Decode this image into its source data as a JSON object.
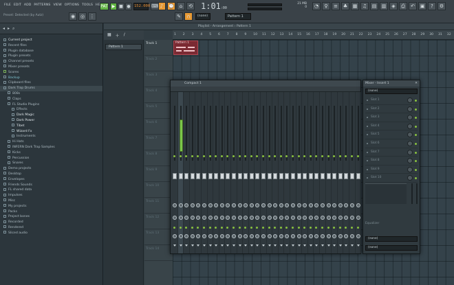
{
  "toolbar": {
    "menu": [
      "FILE",
      "EDIT",
      "ADD",
      "PATTERNS",
      "VIEW",
      "OPTIONS",
      "TOOLS",
      "HELP"
    ],
    "hint": "Preset: Detected (by Autz)",
    "pat_label": "PAT",
    "tempo": "152.000",
    "clock": "1:01",
    "clock_sub": ":00",
    "cpu_label": "21 MB",
    "cpu_value": "0",
    "line_mode": "(none)",
    "pattern": "Pattern 1"
  },
  "browser": {
    "items": [
      {
        "label": "Current project",
        "indent": 0,
        "style": "white"
      },
      {
        "label": "Recent files",
        "indent": 0,
        "style": ""
      },
      {
        "label": "Plugin database",
        "indent": 0,
        "style": ""
      },
      {
        "label": "Plugin presets",
        "indent": 0,
        "style": ""
      },
      {
        "label": "Channel presets",
        "indent": 0,
        "style": ""
      },
      {
        "label": "Mixer presets",
        "indent": 0,
        "style": ""
      },
      {
        "label": "Scores",
        "indent": 0,
        "style": "green"
      },
      {
        "label": "Backup",
        "indent": 0,
        "style": "cyan"
      },
      {
        "label": "Clipboard files",
        "indent": 0,
        "style": ""
      },
      {
        "label": "Dark Trap Drums",
        "indent": 0,
        "style": "sel"
      },
      {
        "label": "808s",
        "indent": 1,
        "style": ""
      },
      {
        "label": "Claps",
        "indent": 1,
        "style": ""
      },
      {
        "label": "FL Studio Plugins",
        "indent": 1,
        "style": ""
      },
      {
        "label": "Effects",
        "indent": 2,
        "style": ""
      },
      {
        "label": "Dark Magic",
        "indent": 2,
        "style": "white"
      },
      {
        "label": "Dark Power",
        "indent": 2,
        "style": "white"
      },
      {
        "label": "Tibet",
        "indent": 2,
        "style": "white"
      },
      {
        "label": "Wizard Fx",
        "indent": 2,
        "style": "white"
      },
      {
        "label": "Instruments",
        "indent": 2,
        "style": ""
      },
      {
        "label": "Hi Hats",
        "indent": 1,
        "style": ""
      },
      {
        "label": "INFERN Dark Trap Samples",
        "indent": 1,
        "style": ""
      },
      {
        "label": "Kicks",
        "indent": 1,
        "style": ""
      },
      {
        "label": "Percussion",
        "indent": 1,
        "style": ""
      },
      {
        "label": "Snares",
        "indent": 1,
        "style": ""
      },
      {
        "label": "Demo projects",
        "indent": 0,
        "style": ""
      },
      {
        "label": "Desktop",
        "indent": 0,
        "style": ""
      },
      {
        "label": "Envelopes",
        "indent": 0,
        "style": ""
      },
      {
        "label": "Friends Sounds",
        "indent": 0,
        "style": ""
      },
      {
        "label": "FL shared data",
        "indent": 0,
        "style": ""
      },
      {
        "label": "Impulses",
        "indent": 0,
        "style": ""
      },
      {
        "label": "Misc",
        "indent": 0,
        "style": ""
      },
      {
        "label": "My projects",
        "indent": 0,
        "style": ""
      },
      {
        "label": "Packs",
        "indent": 0,
        "style": ""
      },
      {
        "label": "Project bones",
        "indent": 0,
        "style": ""
      },
      {
        "label": "Recorded",
        "indent": 0,
        "style": ""
      },
      {
        "label": "Rendered",
        "indent": 0,
        "style": ""
      },
      {
        "label": "Sliced audio",
        "indent": 0,
        "style": ""
      }
    ]
  },
  "playlist": {
    "title": "Playlist - Arrangement › Pattern 1",
    "pattern_item": "Pattern 1",
    "clip_label": "Pattern 1",
    "tracks": [
      "Track 1",
      "Track 2",
      "Track 3",
      "Track 4",
      "Track 5",
      "Track 6",
      "Track 7",
      "Track 8",
      "Track 9",
      "Track 10",
      "Track 11",
      "Track 12",
      "Track 13",
      "Track 14"
    ],
    "ruler": [
      "1",
      "2",
      "3",
      "4",
      "5",
      "6",
      "7",
      "8",
      "9",
      "10",
      "11",
      "12",
      "13",
      "14",
      "15",
      "16",
      "17",
      "18",
      "19",
      "20",
      "21",
      "22",
      "23",
      "24",
      "25",
      "26",
      "27",
      "28",
      "29",
      "30",
      "31",
      "32"
    ]
  },
  "rack": {
    "title": "Compact 1"
  },
  "mixer": {
    "title": "Mixer - Insert 1",
    "preset": "(none)",
    "slots": [
      "Slot 1",
      "Slot 2",
      "Slot 3",
      "Slot 4",
      "Slot 5",
      "Slot 6",
      "Slot 7",
      "Slot 8",
      "Slot 9",
      "Slot 10"
    ],
    "eq_label": "Equalizer",
    "out1": "(none)",
    "out2": "(none)"
  },
  "colors": {
    "accent_green": "#62b544",
    "accent_orange": "#e89a34",
    "clip_red": "#7b2a33"
  }
}
